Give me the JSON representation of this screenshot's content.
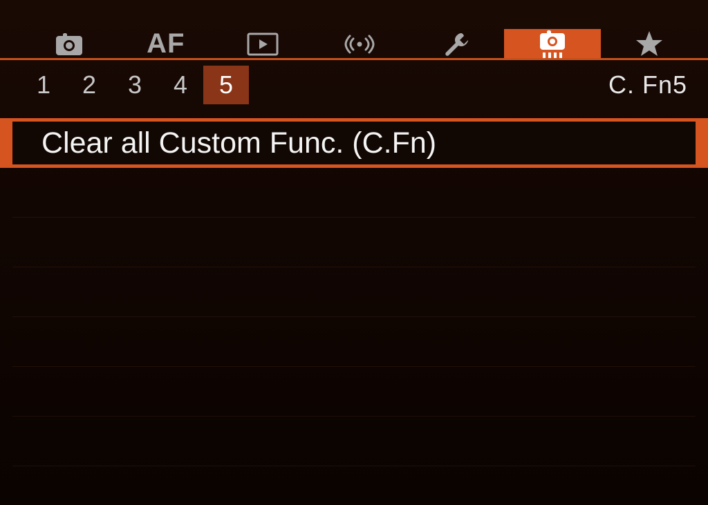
{
  "tabs": {
    "af_label": "AF"
  },
  "pages": {
    "items": [
      "1",
      "2",
      "3",
      "4",
      "5"
    ],
    "label": "C. Fn5"
  },
  "menu": {
    "item0": "Clear all Custom Func. (C.Fn)"
  }
}
